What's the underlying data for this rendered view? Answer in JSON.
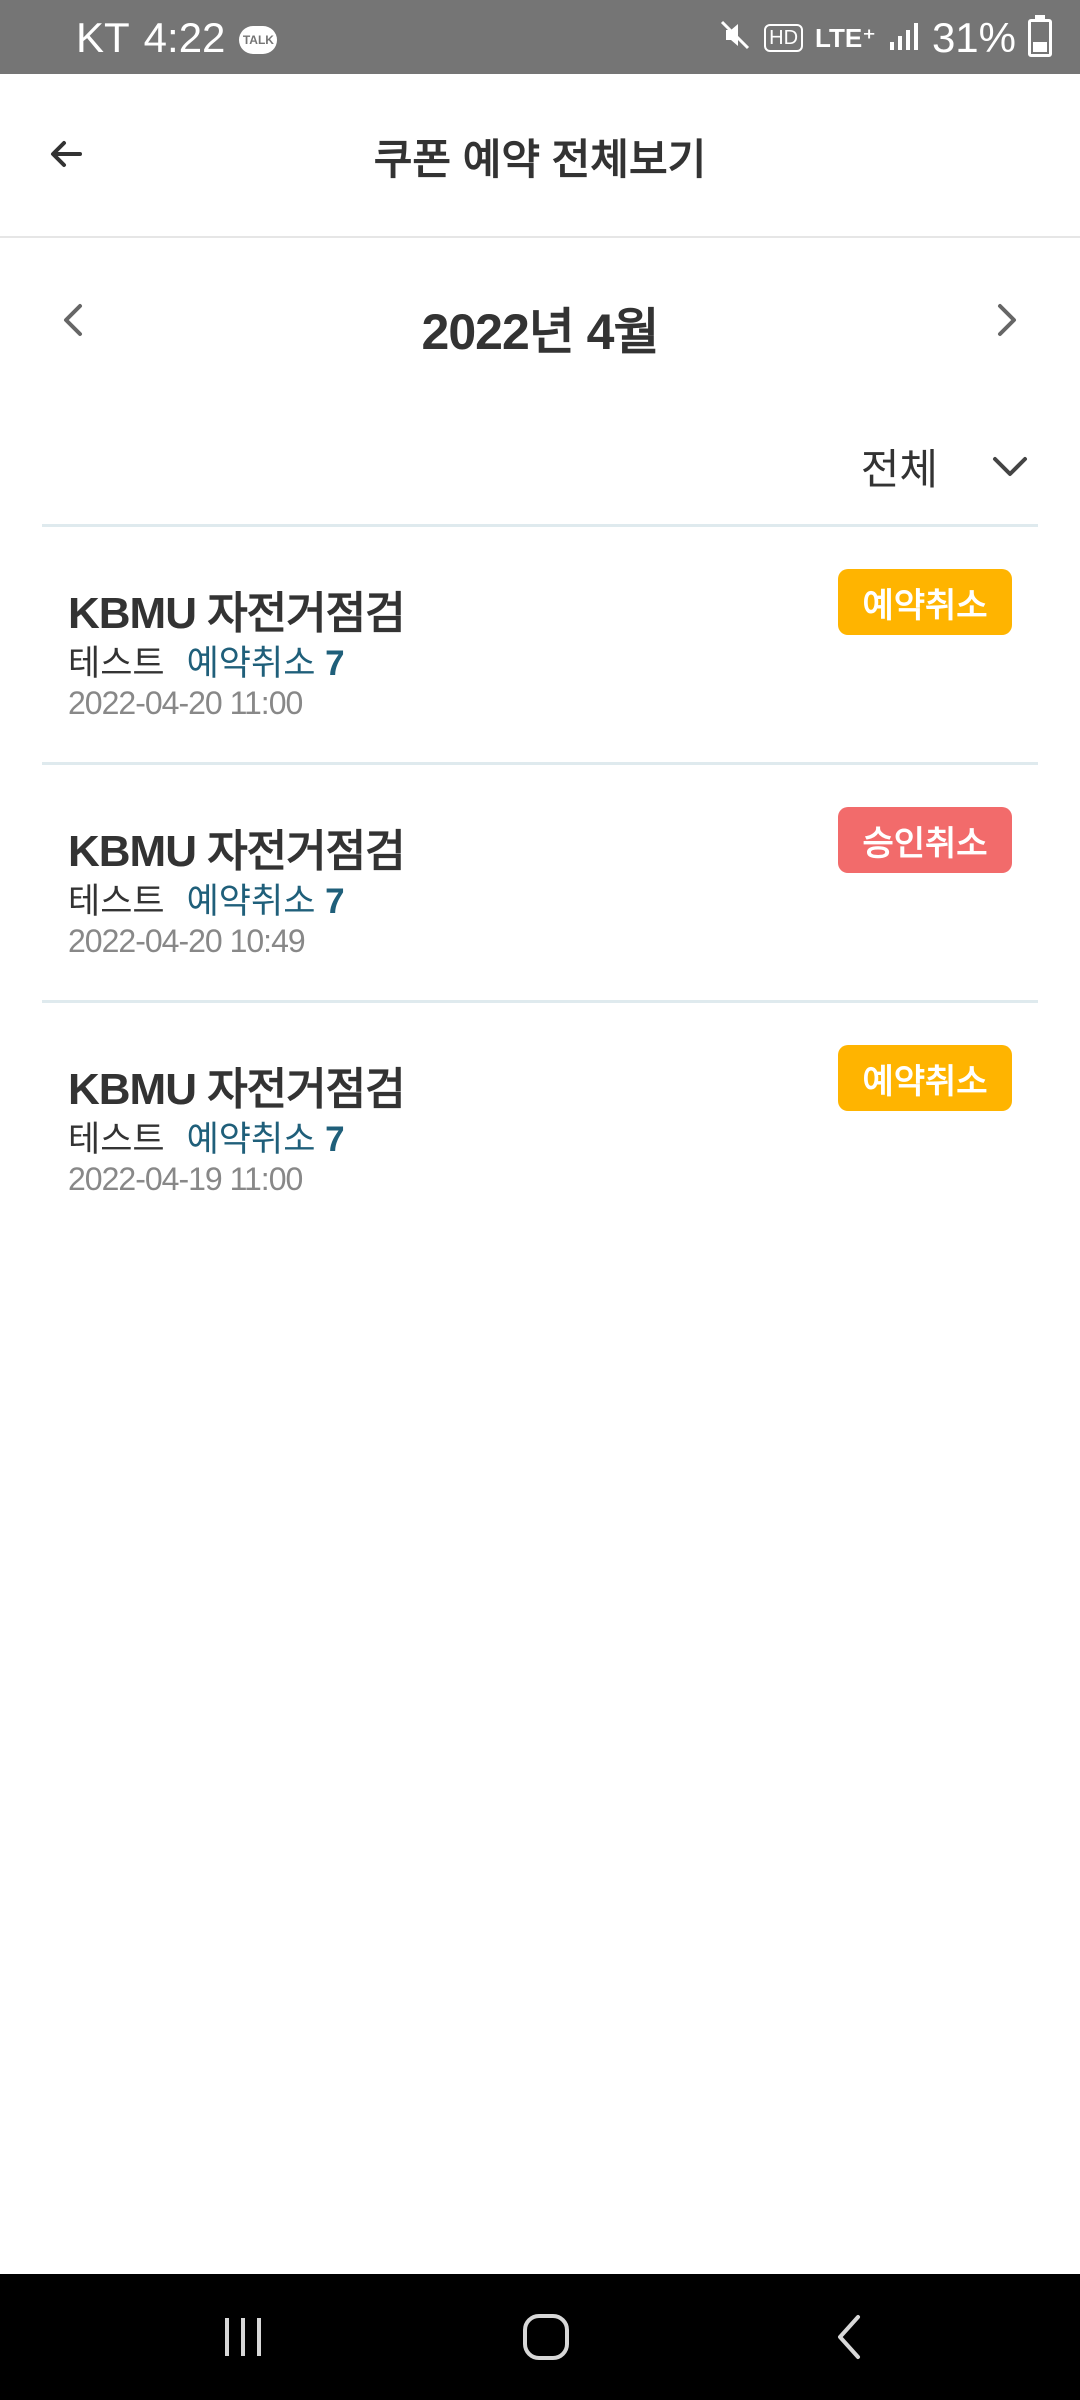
{
  "status_bar": {
    "carrier": "KT",
    "time": "4:22",
    "talk_icon_text": "TALK",
    "hd_text": "HD",
    "lte_text": "LTE⁺",
    "battery": "31%",
    "icons": [
      "talk-icon",
      "mute-icon",
      "hd-icon",
      "lte-icon",
      "signal-icon",
      "battery-icon"
    ]
  },
  "header": {
    "title": "쿠폰 예약 전체보기",
    "back_icon": "arrow-left-icon"
  },
  "month_nav": {
    "label": "2022년 4월",
    "prev_icon": "chevron-left-icon",
    "next_icon": "chevron-right-icon"
  },
  "filter": {
    "selected": "전체",
    "icon": "chevron-down-icon"
  },
  "reservations": [
    {
      "title": "KBMU 자전거점검",
      "subname": "테스트",
      "status": "예약취소",
      "count": "7",
      "date": "2022-04-20 11:00",
      "badge": "예약취소",
      "badge_color": "#FFB400"
    },
    {
      "title": "KBMU 자전거점검",
      "subname": "테스트",
      "status": "예약취소",
      "count": "7",
      "date": "2022-04-20 10:49",
      "badge": "승인취소",
      "badge_color": "#F26B6B"
    },
    {
      "title": "KBMU 자전거점검",
      "subname": "테스트",
      "status": "예약취소",
      "count": "7",
      "date": "2022-04-19 11:00",
      "badge": "예약취소",
      "badge_color": "#FFB400"
    }
  ],
  "nav_bar": {
    "icons": [
      "recent-apps-icon",
      "home-icon",
      "back-icon"
    ]
  },
  "colors": {
    "status_bar_bg": "#757575",
    "accent_text": "#1f5f7a",
    "badge_orange": "#FFB400",
    "badge_red": "#F26B6B"
  }
}
